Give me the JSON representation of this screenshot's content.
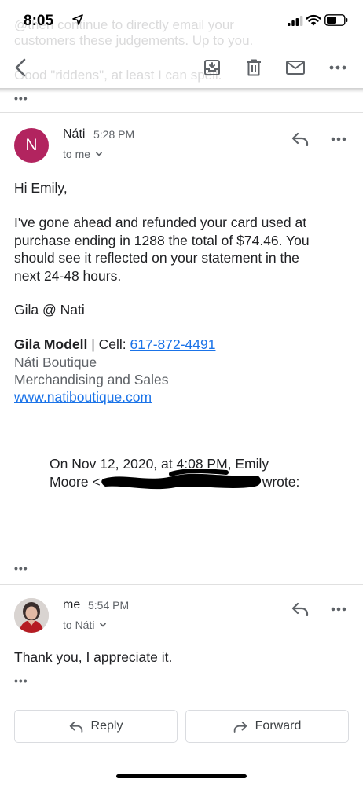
{
  "status_bar": {
    "time": "8:05"
  },
  "ghost_text": {
    "line1": "@then continue to directly email your",
    "line2": "customers these judgements. Up to you.",
    "line3": "Good \"riddens\", at least I can spell."
  },
  "toolbar": {
    "back_icon": "back-arrow-icon",
    "archive_icon": "archive-icon",
    "delete_icon": "trash-icon",
    "mark_unread_icon": "mail-icon",
    "more_icon": "more-horizontal-icon"
  },
  "collapsed_dots": "•••",
  "message1": {
    "avatar_letter": "N",
    "avatar_color": "#b2245f",
    "sender": "Náti",
    "time": "5:28 PM",
    "to": "to me",
    "greeting": "Hi Emily,",
    "paragraph": [
      "I've gone ahead and refunded your card used at",
      "purchase ending in 1288 the total of $74.46. You",
      "should see it reflected on your statement in the",
      "next 24-48 hours."
    ],
    "signoff": "Gila @ Nati",
    "sig_name": "Gila Modell",
    "sig_sep": " | Cell: ",
    "sig_phone": "617-872-4491",
    "sig_company": "Náti Boutique",
    "sig_dept": "Merchandising and Sales",
    "sig_site": "www.natiboutique.com",
    "quote_line1": "On Nov 12, 2020, at 4:08 PM, Emily",
    "quote_line2_start": "Moore <",
    "quote_line2_end": "wrote:"
  },
  "message2": {
    "sender": "me",
    "time": "5:54 PM",
    "to": "to Náti",
    "body": "Thank you, I appreciate it."
  },
  "actions": {
    "reply": "Reply",
    "forward": "Forward"
  },
  "colors": {
    "link": "#1a73e8",
    "muted": "#5f6368",
    "divider": "#e0e0e0"
  }
}
